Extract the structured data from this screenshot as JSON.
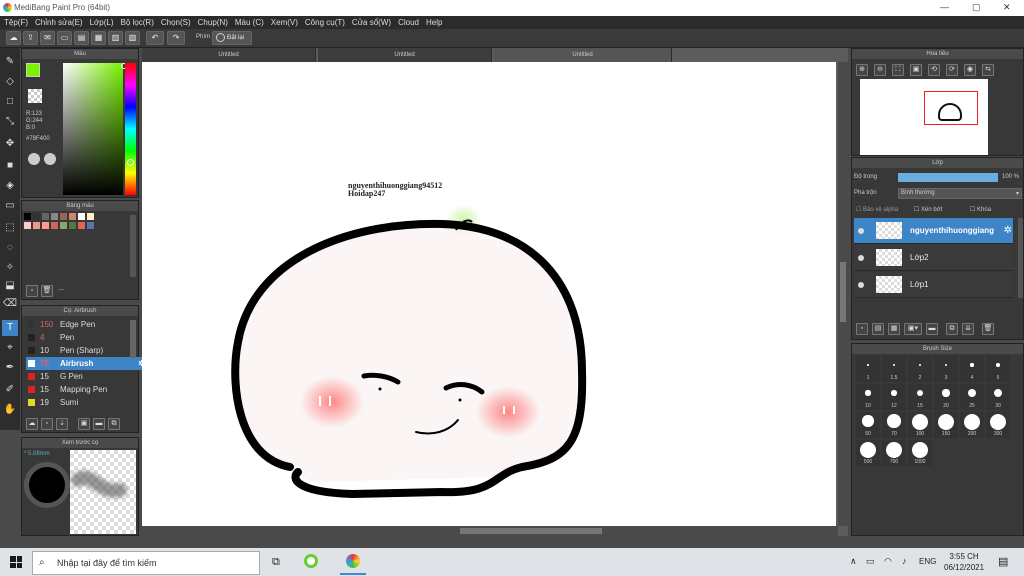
{
  "window": {
    "title": "MediBang Paint Pro (64bit)",
    "minimize": "—",
    "maximize": "▢",
    "close": "✕"
  },
  "menu": [
    "Tệp(F)",
    "Chỉnh sửa(E)",
    "Lớp(L)",
    "Bộ lọc(R)",
    "Chọn(S)",
    "Chụp(N)",
    "Màu (C)",
    "Xem(V)",
    "Công cụ(T)",
    "Cửa sổ(W)",
    "Cloud",
    "Help"
  ],
  "toolbar": {
    "phim_label": "Phím",
    "reset_label": "Đặt lại"
  },
  "doc_tabs": [
    "Untitled",
    "Untitled",
    "Untitled"
  ],
  "color_panel": {
    "title": "Màu",
    "r": "R:123",
    "g": "G:244",
    "b": "B:0",
    "hex": "#78F400",
    "primary": "#78F400",
    "secondary": "#000000"
  },
  "palette_panel": {
    "title": "Bảng màu",
    "name_placeholder": "---",
    "colors": [
      "#000000",
      "#333333",
      "#666666",
      "#888888",
      "#996655",
      "#cc8866",
      "#ffffff",
      "#ffeecc",
      "#ffcccc",
      "#ee9988",
      "#ff9999",
      "#cc6655",
      "#88aa66",
      "#557744",
      "#dd6655",
      "#5577aa"
    ]
  },
  "brush_panel": {
    "title": "Cọ: Airbrush",
    "brushes": [
      {
        "size": "150",
        "name": "Edge Pen",
        "color": "#333333",
        "size_color": "#e06060"
      },
      {
        "size": "4",
        "name": "Pen",
        "color": "#222222",
        "size_color": "#e06060"
      },
      {
        "size": "10",
        "name": "Pen (Sharp)",
        "color": "#222222",
        "size_color": "#dddddd"
      },
      {
        "size": "70",
        "name": "Airbrush",
        "color": "#ffffff",
        "size_color": "#e06060",
        "selected": true
      },
      {
        "size": "15",
        "name": "G Pen",
        "color": "#dd2222",
        "size_color": "#dddddd"
      },
      {
        "size": "15",
        "name": "Mapping Pen",
        "color": "#dd2222",
        "size_color": "#dddddd"
      },
      {
        "size": "19",
        "name": "Sumi",
        "color": "#dddd22",
        "size_color": "#dddddd"
      }
    ]
  },
  "preview_panel": {
    "title": "Xem trước cọ",
    "size_label": "* 5.08mm"
  },
  "canvas": {
    "text_line1": "nguyenthihuonggiang94512",
    "text_line2": "Hoidap247"
  },
  "navigator": {
    "title": "Hoa tiêu"
  },
  "layer_panel": {
    "title": "Lớp",
    "opacity_label": "Độ trong",
    "opacity_value": "100 %",
    "opacity_level": 1.0,
    "blend_label": "Pha trộn",
    "blend_value": "Bình thường",
    "alpha_protect": "Bảo vệ alpha",
    "clipping": "Xén bớt",
    "lock": "Khóa",
    "layers": [
      {
        "name": "nguyenthihuonggiang",
        "selected": true
      },
      {
        "name": "Lớp2",
        "selected": false
      },
      {
        "name": "Lớp1",
        "selected": false
      }
    ]
  },
  "brush_size_panel": {
    "title": "Brush Size",
    "sizes": [
      "1",
      "1.5",
      "2",
      "3",
      "4",
      "5",
      "10",
      "12",
      "15",
      "20",
      "25",
      "30",
      "50",
      "70",
      "100",
      "150",
      "200",
      "300",
      "500",
      "700",
      "1000"
    ]
  },
  "taskbar": {
    "search_placeholder": "Nhập tại đây để tìm kiếm",
    "lang": "ENG",
    "time": "3:55 CH",
    "date": "06/12/2021"
  }
}
